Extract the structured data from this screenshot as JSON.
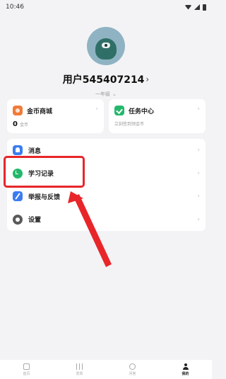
{
  "status_bar": {
    "time": "10:46"
  },
  "profile": {
    "username": "用户545407214",
    "chevron": "›",
    "level": "一年级",
    "level_chevron": "⌄"
  },
  "cards": {
    "coins": {
      "title": "金币商城",
      "count": "0",
      "unit": "金币",
      "chevron": "›"
    },
    "tasks": {
      "title": "任务中心",
      "subtitle": "立刻签到领金币",
      "chevron": "›"
    }
  },
  "menu": [
    {
      "label": "消息",
      "icon": "bell-icon"
    },
    {
      "label": "学习记录",
      "icon": "clock-icon"
    },
    {
      "label": "举报与反馈",
      "icon": "report-icon"
    },
    {
      "label": "设置",
      "icon": "gear-icon"
    }
  ],
  "menu_chevron": "›",
  "bottom_nav": [
    {
      "label": "首页",
      "icon": "home-icon"
    },
    {
      "label": "发现",
      "icon": "bars-icon"
    },
    {
      "label": "问答",
      "icon": "chat-icon"
    },
    {
      "label": "我的",
      "icon": "user-icon"
    }
  ],
  "colors": {
    "highlight": "#e8262a",
    "accent_green": "#23b86b",
    "accent_blue": "#3b7cf2",
    "accent_orange": "#f07b3a"
  }
}
